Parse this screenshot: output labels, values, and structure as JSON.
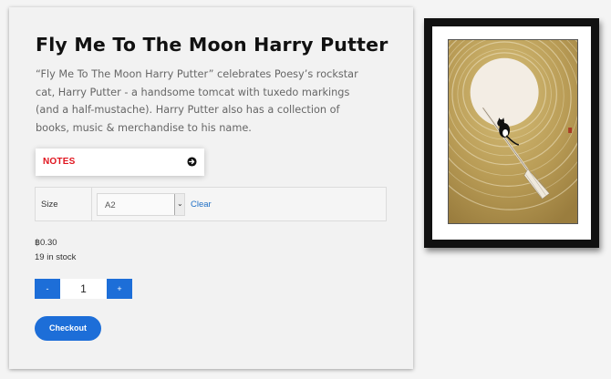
{
  "product": {
    "title": "Fly Me To The Moon Harry Putter",
    "description": "“Fly Me To The Moon Harry Putter” celebrates Poesy’s rockstar cat, Harry Putter - a handsome tomcat with tuxedo markings (and a half-mustache). Harry Putter also has a collection of books, music & merchandise to his name.",
    "price": "฿0.30",
    "stock": "19 in stock"
  },
  "notes": {
    "label": "NOTES",
    "icon": "arrow-right-circle-icon",
    "color": "#e0141e"
  },
  "variation": {
    "label": "Size",
    "selected": "A2",
    "clear_label": "Clear"
  },
  "quantity": {
    "minus_label": "-",
    "value": "1",
    "plus_label": "+"
  },
  "checkout": {
    "label": "Checkout"
  },
  "colors": {
    "accent": "#1d6ed8",
    "notes_red": "#e0141e",
    "link": "#1f6fc5"
  }
}
